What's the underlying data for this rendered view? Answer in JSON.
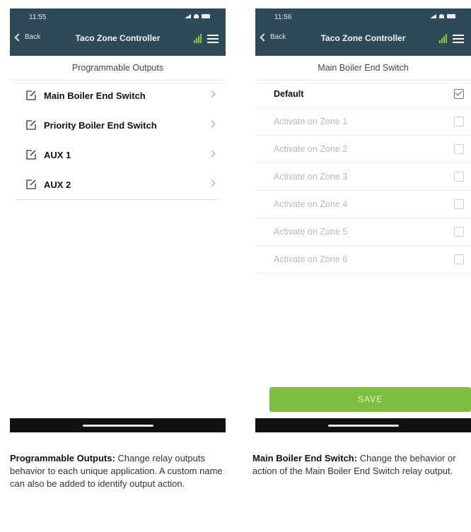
{
  "left_screen": {
    "status_time": "11:55",
    "back_label": "Back",
    "app_title": "Taco Zone Controller",
    "subtitle": "Programmable Outputs",
    "outputs": [
      {
        "label": "Main Boiler End Switch"
      },
      {
        "label": "Priority Boiler End Switch"
      },
      {
        "label": "AUX 1"
      },
      {
        "label": "AUX 2"
      }
    ]
  },
  "right_screen": {
    "status_time": "11:56",
    "back_label": "Back",
    "app_title": "Taco Zone Controller",
    "subtitle": "Main Boiler End Switch",
    "options": [
      {
        "label": "Default",
        "checked": true
      },
      {
        "label": "Activate on Zone 1",
        "checked": false
      },
      {
        "label": "Activate on Zone 2",
        "checked": false
      },
      {
        "label": "Activate on Zone 3",
        "checked": false
      },
      {
        "label": "Activate on Zone 4",
        "checked": false
      },
      {
        "label": "Activate on Zone 5",
        "checked": false
      },
      {
        "label": "Activate on Zone 6",
        "checked": false
      }
    ],
    "save_label": "SAVE"
  },
  "captions": {
    "left_title": "Programmable Outputs:",
    "left_text": " Change relay outputs behavior to each unique application. A custom name can also be added to identify output action.",
    "right_title": "Main Boiler End Switch:",
    "right_text": " Change the behavior or action of the Main Boiler End Switch relay output."
  },
  "icons": {
    "back": "chevron-left-icon",
    "signal": "signal-bars-icon",
    "menu": "hamburger-menu-icon",
    "edit": "edit-icon",
    "row_arrow": "chevron-right-icon",
    "checkbox": "checkbox-icon"
  },
  "colors": {
    "header": "#2e4a58",
    "signal_bars": "#8cc83f",
    "save_button": "#7dbd3f"
  }
}
